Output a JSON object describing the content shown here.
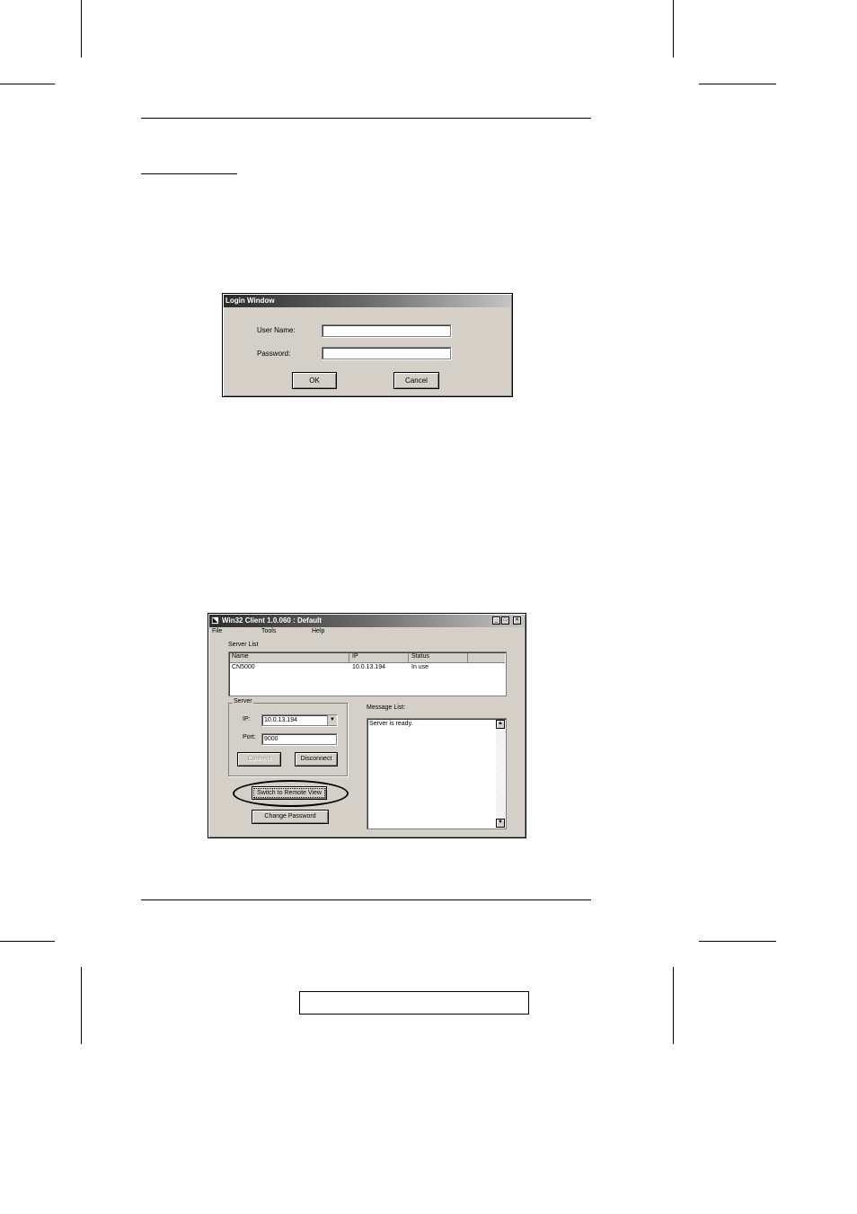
{
  "login_window": {
    "title": "Login Window",
    "username_label": "User Name:",
    "username_value": "",
    "password_label": "Password:",
    "password_value": "",
    "ok_label": "OK",
    "cancel_label": "Cancel"
  },
  "client_window": {
    "title": "Win32 Client 1.0.060 : Default",
    "menu": [
      "File",
      "Tools",
      "Help"
    ],
    "server_list": {
      "label": "Server List",
      "columns": [
        "Name",
        "IP",
        "Status"
      ],
      "rows": [
        {
          "name": "CN5000",
          "ip": "10.0.13.194",
          "status": "In use"
        }
      ]
    },
    "server_group": {
      "label": "Server",
      "ip_label": "IP:",
      "ip_value": "10.0.13.194",
      "port_label": "Port:",
      "port_value": "9000",
      "connect_label": "Connect",
      "disconnect_label": "Disconnect"
    },
    "switch_button_label": "Switch to Remote View",
    "change_password_label": "Change Password",
    "message_list": {
      "label": "Message List:",
      "messages": [
        "Server is ready."
      ]
    }
  }
}
